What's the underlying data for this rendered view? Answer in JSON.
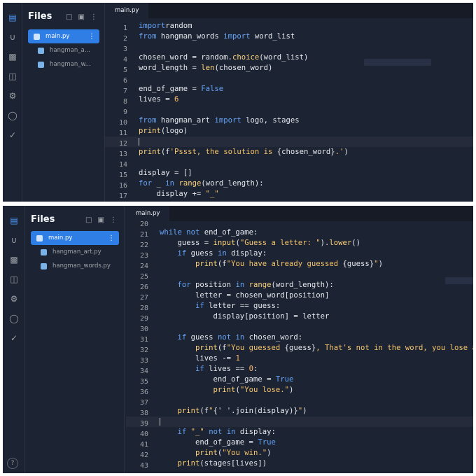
{
  "sidebar": {
    "title": "Files",
    "files_top": [
      "main.py",
      "hangman_a...",
      "hangman_w..."
    ],
    "files_bottom": [
      "main.py",
      "hangman_art.py",
      "hangman_words.py"
    ]
  },
  "tab": {
    "label": "main.py"
  },
  "top_lines": [
    {
      "n": "1",
      "c": [
        [
          "kw",
          "import"
        ],
        [
          "",
          "random"
        ]
      ]
    },
    {
      "n": "2",
      "c": [
        [
          "kw",
          "from"
        ],
        [
          "",
          " hangman_words "
        ],
        [
          "kw",
          "import"
        ],
        [
          "",
          " word_list"
        ]
      ]
    },
    {
      "n": "3",
      "c": []
    },
    {
      "n": "4",
      "c": [
        [
          "",
          "chosen_word = random."
        ],
        [
          "fn",
          "choice"
        ],
        [
          "",
          "(word_list)"
        ]
      ]
    },
    {
      "n": "5",
      "c": [
        [
          "",
          "word_length = "
        ],
        [
          "fn",
          "len"
        ],
        [
          "",
          "(chosen_word)"
        ]
      ]
    },
    {
      "n": "6",
      "c": []
    },
    {
      "n": "7",
      "c": [
        [
          "",
          "end_of_game = "
        ],
        [
          "bool",
          "False"
        ]
      ]
    },
    {
      "n": "8",
      "c": [
        [
          "",
          "lives = "
        ],
        [
          "num",
          "6"
        ]
      ]
    },
    {
      "n": "9",
      "c": []
    },
    {
      "n": "10",
      "c": [
        [
          "kw",
          "from"
        ],
        [
          "",
          " hangman_art "
        ],
        [
          "kw",
          "import"
        ],
        [
          "",
          " logo, stages"
        ]
      ]
    },
    {
      "n": "11",
      "c": [
        [
          "fn",
          "print"
        ],
        [
          "",
          "(logo)"
        ]
      ]
    },
    {
      "n": "12",
      "c": [],
      "hl": true
    },
    {
      "n": "13",
      "c": [
        [
          "fn",
          "print"
        ],
        [
          "",
          "(f"
        ],
        [
          "str",
          "'Pssst, the solution is "
        ],
        [
          "",
          "{chosen_word}"
        ],
        [
          "str",
          ".'"
        ],
        [
          "",
          ")"
        ]
      ]
    },
    {
      "n": "14",
      "c": []
    },
    {
      "n": "15",
      "c": [
        [
          "",
          "display = []"
        ]
      ]
    },
    {
      "n": "16",
      "c": [
        [
          "kw",
          "for"
        ],
        [
          "",
          " _ "
        ],
        [
          "kw",
          "in"
        ],
        [
          "",
          " "
        ],
        [
          "fn",
          "range"
        ],
        [
          "",
          "(word_length):"
        ]
      ]
    },
    {
      "n": "17",
      "c": [
        [
          "",
          "    display += "
        ],
        [
          "str",
          "\"_\""
        ]
      ]
    }
  ],
  "bottom_lines": [
    {
      "n": "20",
      "c": []
    },
    {
      "n": "21",
      "c": [
        [
          "kw",
          "while not"
        ],
        [
          "",
          " end_of_game:"
        ]
      ]
    },
    {
      "n": "22",
      "c": [
        [
          "",
          "    guess = "
        ],
        [
          "fn",
          "input"
        ],
        [
          "",
          "("
        ],
        [
          "str",
          "\"Guess a letter: \""
        ],
        [
          "",
          ")."
        ],
        [
          "fn",
          "lower"
        ],
        [
          "",
          "()"
        ]
      ]
    },
    {
      "n": "23",
      "c": [
        [
          "",
          "    "
        ],
        [
          "kw",
          "if"
        ],
        [
          "",
          " guess "
        ],
        [
          "kw",
          "in"
        ],
        [
          "",
          " display:"
        ]
      ]
    },
    {
      "n": "24",
      "c": [
        [
          "",
          "        "
        ],
        [
          "fn",
          "print"
        ],
        [
          "",
          "(f"
        ],
        [
          "str",
          "\"You have already guessed "
        ],
        [
          "",
          "{guess}"
        ],
        [
          "str",
          "\""
        ],
        [
          "",
          ")"
        ]
      ]
    },
    {
      "n": "25",
      "c": []
    },
    {
      "n": "26",
      "c": [
        [
          "",
          "    "
        ],
        [
          "kw",
          "for"
        ],
        [
          "",
          " position "
        ],
        [
          "kw",
          "in"
        ],
        [
          "",
          " "
        ],
        [
          "fn",
          "range"
        ],
        [
          "",
          "(word_length):"
        ]
      ]
    },
    {
      "n": "27",
      "c": [
        [
          "",
          "        letter = chosen_word[position]"
        ]
      ]
    },
    {
      "n": "28",
      "c": [
        [
          "",
          "        "
        ],
        [
          "kw",
          "if"
        ],
        [
          "",
          " letter == guess:"
        ]
      ]
    },
    {
      "n": "29",
      "c": [
        [
          "",
          "            display[position] = letter"
        ]
      ]
    },
    {
      "n": "30",
      "c": []
    },
    {
      "n": "31",
      "c": [
        [
          "",
          "    "
        ],
        [
          "kw",
          "if"
        ],
        [
          "",
          " guess "
        ],
        [
          "kw",
          "not in"
        ],
        [
          "",
          " chosen_word:"
        ]
      ]
    },
    {
      "n": "32",
      "c": [
        [
          "",
          "        "
        ],
        [
          "fn",
          "print"
        ],
        [
          "",
          "(f"
        ],
        [
          "str",
          "\"You guessed "
        ],
        [
          "",
          "{guess}"
        ],
        [
          "str",
          ", That's not in the word, you lose a l"
        ]
      ]
    },
    {
      "n": "33",
      "c": [
        [
          "",
          "        lives -= "
        ],
        [
          "num",
          "1"
        ]
      ]
    },
    {
      "n": "34",
      "c": [
        [
          "",
          "        "
        ],
        [
          "kw",
          "if"
        ],
        [
          "",
          " lives == "
        ],
        [
          "num",
          "0"
        ],
        [
          "",
          ":"
        ]
      ]
    },
    {
      "n": "35",
      "c": [
        [
          "",
          "            end_of_game = "
        ],
        [
          "bool",
          "True"
        ]
      ]
    },
    {
      "n": "36",
      "c": [
        [
          "",
          "            "
        ],
        [
          "fn",
          "print"
        ],
        [
          "",
          "("
        ],
        [
          "str",
          "\"You lose.\""
        ],
        [
          "",
          ")"
        ]
      ]
    },
    {
      "n": "37",
      "c": []
    },
    {
      "n": "38",
      "c": [
        [
          "",
          "    "
        ],
        [
          "fn",
          "print"
        ],
        [
          "",
          "(f"
        ],
        [
          "str",
          "\""
        ],
        [
          "",
          "{' '.join(display)}"
        ],
        [
          "str",
          "\""
        ],
        [
          "",
          ")"
        ]
      ]
    },
    {
      "n": "39",
      "c": [],
      "hl": true
    },
    {
      "n": "40",
      "c": [
        [
          "",
          "    "
        ],
        [
          "kw",
          "if"
        ],
        [
          "",
          " "
        ],
        [
          "str",
          "\"_\""
        ],
        [
          "",
          " "
        ],
        [
          "kw",
          "not in"
        ],
        [
          "",
          " display:"
        ]
      ]
    },
    {
      "n": "41",
      "c": [
        [
          "",
          "        end_of_game = "
        ],
        [
          "bool",
          "True"
        ]
      ]
    },
    {
      "n": "42",
      "c": [
        [
          "",
          "        "
        ],
        [
          "fn",
          "print"
        ],
        [
          "",
          "("
        ],
        [
          "str",
          "\"You win.\""
        ],
        [
          "",
          ")"
        ]
      ]
    },
    {
      "n": "43",
      "c": [
        [
          "",
          "    "
        ],
        [
          "fn",
          "print"
        ],
        [
          "",
          "(stages[lives])"
        ]
      ]
    }
  ],
  "help": {
    "label": "?"
  },
  "icons": [
    "files-icon",
    "share-icon",
    "packages-icon",
    "lock-icon",
    "settings-icon",
    "database-icon",
    "check-icon"
  ]
}
